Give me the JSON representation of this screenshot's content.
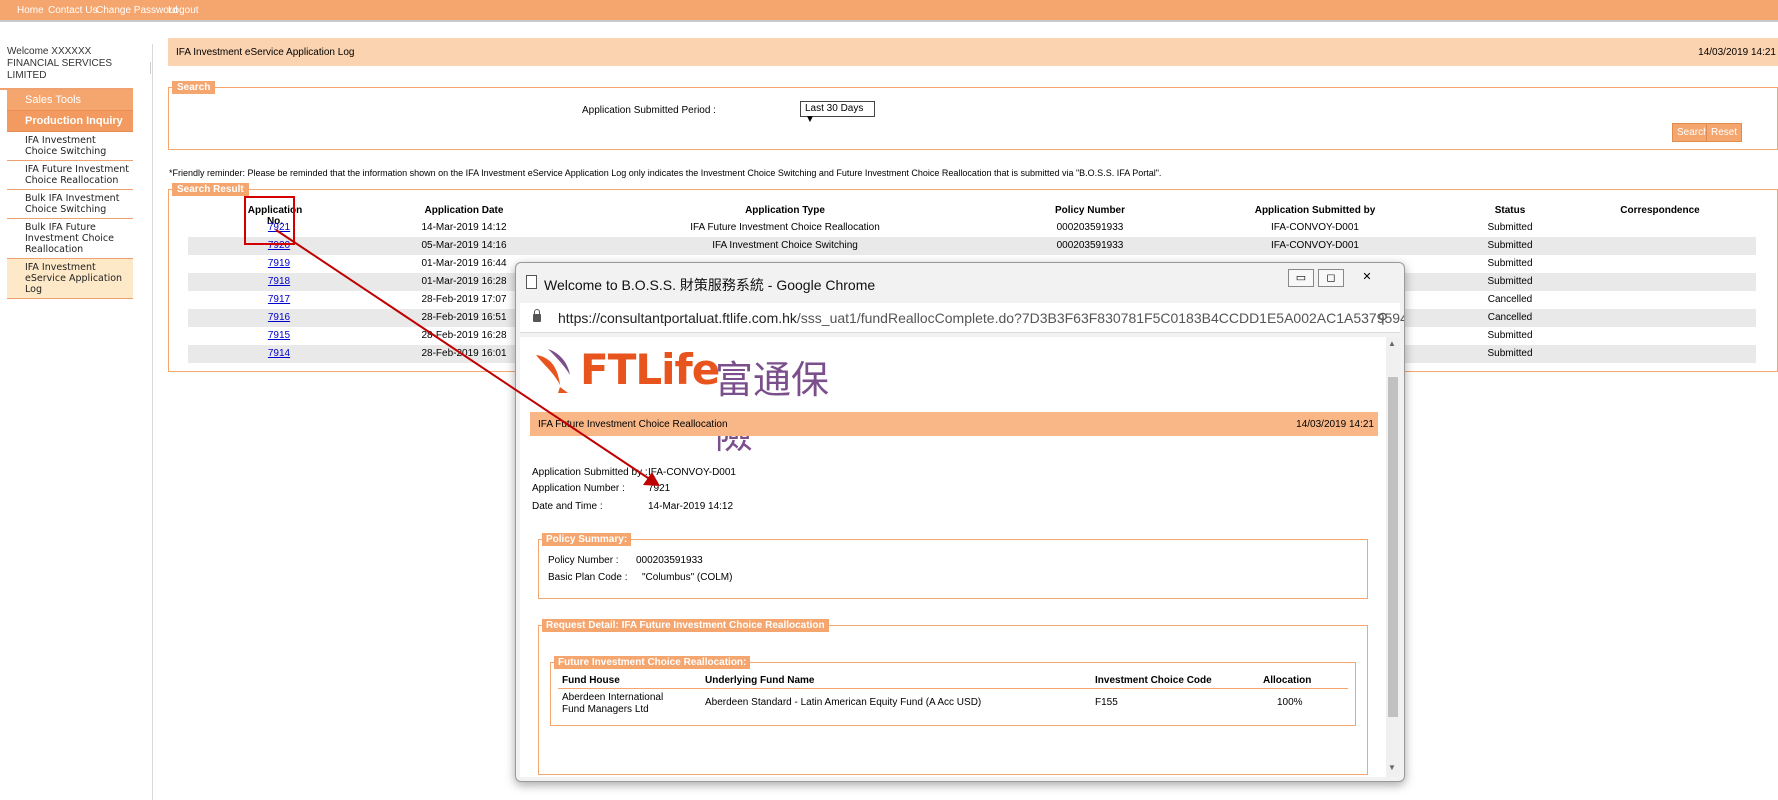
{
  "topnav": {
    "links": [
      "Home",
      "Contact Us",
      "Change Password",
      "Logout"
    ]
  },
  "sidebar": {
    "welcome": "Welcome XXXXXX FINANCIAL SERVICES LIMITED",
    "sales_tools": "Sales Tools",
    "production_inquiry": "Production Inquiry",
    "items": [
      {
        "label": "IFA Investment Choice Switching"
      },
      {
        "label": "IFA Future Investment Choice Reallocation"
      },
      {
        "label": "Bulk IFA Investment Choice Switching"
      },
      {
        "label": "Bulk IFA Future Investment Choice Reallocation"
      },
      {
        "label": "IFA Investment eService Application Log"
      }
    ]
  },
  "main": {
    "title": "IFA Investment eService Application Log",
    "datetime": "14/03/2019 14:21",
    "search_legend": "Search",
    "period_label": "Application Submitted Period :",
    "period_value": "Last 30 Days ▼",
    "search_btn": "Search",
    "reset_btn": "Reset",
    "reminder": "*Friendly reminder: Please be reminded that the information shown on the IFA Investment eService Application Log only indicates the Investment Choice Switching and Future Investment Choice Reallocation that is submitted via \"B.O.S.S. IFA Portal\".",
    "result_legend": "Search Result",
    "columns": [
      "Application No.",
      "Application Date",
      "Application Type",
      "Policy Number",
      "Application Submitted by",
      "Status",
      "Correspondence"
    ],
    "rows": [
      {
        "no": "7921",
        "date": "14-Mar-2019 14:12",
        "type": "IFA Future Investment Choice Reallocation",
        "policy": "000203591933",
        "by": "IFA-CONVOY-D001",
        "status": "Submitted"
      },
      {
        "no": "7920",
        "date": "05-Mar-2019 14:16",
        "type": "IFA Investment Choice Switching",
        "policy": "000203591933",
        "by": "IFA-CONVOY-D001",
        "status": "Submitted"
      },
      {
        "no": "7919",
        "date": "01-Mar-2019 16:44",
        "type": "",
        "policy": "",
        "by": "",
        "status": "Submitted"
      },
      {
        "no": "7918",
        "date": "01-Mar-2019 16:28",
        "type": "",
        "policy": "",
        "by": "",
        "status": "Submitted"
      },
      {
        "no": "7917",
        "date": "28-Feb-2019 17:07",
        "type": "",
        "policy": "",
        "by": "",
        "status": "Cancelled"
      },
      {
        "no": "7916",
        "date": "28-Feb-2019 16:51",
        "type": "",
        "policy": "",
        "by": "",
        "status": "Cancelled"
      },
      {
        "no": "7915",
        "date": "28-Feb-2019 16:28",
        "type": "",
        "policy": "",
        "by": "",
        "status": "Submitted"
      },
      {
        "no": "7914",
        "date": "28-Feb-2019 16:01",
        "type": "",
        "policy": "",
        "by": "",
        "status": "Submitted"
      }
    ]
  },
  "popup": {
    "title": "Welcome to  B.O.S.S. 財策服務系統 - Google Chrome",
    "url_host": "https://consultantportaluat.ftlife.com.hk",
    "url_path": "/sss_uat1/fundReallocComplete.do?7D3B3F63F830781F5C0183B4CCDD1E5A002AC1A5379594B8E3...",
    "logo_text": "FTLife",
    "logo_cn": "富通保險",
    "header_title": "IFA Future Investment Choice Reallocation",
    "header_date": "14/03/2019 14:21",
    "submitted_by_label": "Application Submitted by :",
    "submitted_by": "IFA-CONVOY-D001",
    "app_number_label": "Application Number :",
    "app_number": "7921",
    "datetime_label": "Date and Time :",
    "datetime": "14-Mar-2019 14:12",
    "policy_summary_legend": "Policy Summary:",
    "policy_number_label": "Policy Number :",
    "policy_number": "000203591933",
    "plan_code_label": "Basic Plan Code :",
    "plan_code": "\"Columbus\" (COLM)",
    "request_legend": "Request Detail: IFA Future Investment Choice Reallocation",
    "future_legend": "Future Investment Choice Reallocation:",
    "fund_columns": [
      "Fund House",
      "Underlying Fund Name",
      "Investment Choice Code",
      "Allocation"
    ],
    "fund_rows": [
      {
        "house": "Aberdeen International Fund Managers Ltd",
        "fund": "Aberdeen Standard - Latin American Equity Fund (A Acc USD)",
        "code": "F155",
        "allocation": "100%"
      }
    ]
  }
}
